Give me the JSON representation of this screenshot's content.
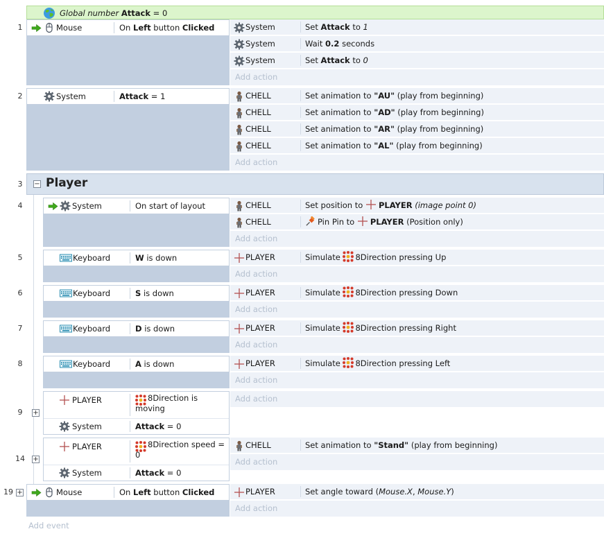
{
  "global_var": {
    "label_italic": "Global number",
    "name": "Attack",
    "value_text": "= 0"
  },
  "events": {
    "e1": {
      "num": "1",
      "cond_obj": "Mouse",
      "cond_pre": "On ",
      "cond_b": "Left",
      "cond_mid": " button ",
      "cond_b2": "Clicked",
      "actions": [
        {
          "obj": "System",
          "pre": "Set ",
          "b": "Attack",
          "mid": " to ",
          "i": "1"
        },
        {
          "obj": "System",
          "pre": "Wait ",
          "b": "0.2",
          "mid": " seconds"
        },
        {
          "obj": "System",
          "pre": "Set ",
          "b": "Attack",
          "mid": " to ",
          "i": "0"
        }
      ]
    },
    "e2": {
      "num": "2",
      "cond_obj": "System",
      "cond_b": "Attack",
      "cond_rest": " = 1",
      "actions": [
        {
          "obj": "CHELL",
          "pre": "Set animation to ",
          "b": "\"AU\"",
          "post": " (play from beginning)"
        },
        {
          "obj": "CHELL",
          "pre": "Set animation to ",
          "b": "\"AD\"",
          "post": " (play from beginning)"
        },
        {
          "obj": "CHELL",
          "pre": "Set animation to ",
          "b": "\"AR\"",
          "post": " (play from beginning)"
        },
        {
          "obj": "CHELL",
          "pre": "Set animation to ",
          "b": "\"AL\"",
          "post": " (play from beginning)"
        }
      ]
    },
    "g3": {
      "num": "3",
      "title": "Player",
      "collapse": "−"
    },
    "e4": {
      "num": "4",
      "cond_obj": "System",
      "cond_text": "On start of layout",
      "actions": [
        {
          "obj": "CHELL",
          "pre": "Set position to ",
          "b": "PLAYER",
          "i": " (image point 0)"
        },
        {
          "obj": "CHELL",
          "pre": "Pin Pin to ",
          "b": "PLAYER",
          "post": " (Position only)"
        }
      ]
    },
    "e5": {
      "num": "5",
      "cond_obj": "Keyboard",
      "cond_b": "W",
      "cond_rest": " is down",
      "act_obj": "PLAYER",
      "act_pre": "Simulate ",
      "act_post": "8Direction pressing Up"
    },
    "e6": {
      "num": "6",
      "cond_obj": "Keyboard",
      "cond_b": "S",
      "cond_rest": " is down",
      "act_obj": "PLAYER",
      "act_pre": "Simulate ",
      "act_post": "8Direction pressing Down"
    },
    "e7": {
      "num": "7",
      "cond_obj": "Keyboard",
      "cond_b": "D",
      "cond_rest": " is down",
      "act_obj": "PLAYER",
      "act_pre": "Simulate ",
      "act_post": "8Direction pressing Right"
    },
    "e8": {
      "num": "8",
      "cond_obj": "Keyboard",
      "cond_b": "A",
      "cond_rest": " is down",
      "act_obj": "PLAYER",
      "act_pre": "Simulate ",
      "act_post": "8Direction pressing Left"
    },
    "e9": {
      "num": "9",
      "expand": "+",
      "c1_obj": "PLAYER",
      "c1_text1": "8Direction is",
      "c1_text2": "moving",
      "c2_obj": "System",
      "c2_b": "Attack",
      "c2_rest": " = 0"
    },
    "e14": {
      "num": "14",
      "expand": "+",
      "c1_obj": "PLAYER",
      "c1_text1": "8Direction speed =",
      "c1_text2": "0",
      "c2_obj": "System",
      "c2_b": "Attack",
      "c2_rest": " = 0",
      "act_obj": "CHELL",
      "act_pre": "Set animation to ",
      "act_b": "\"Stand\"",
      "act_post": " (play from beginning)"
    },
    "e19": {
      "num": "19",
      "expand": "+",
      "cond_obj": "Mouse",
      "cond_pre": "On ",
      "cond_b": "Left",
      "cond_mid": " button ",
      "cond_b2": "Clicked",
      "act_obj": "PLAYER",
      "act_pre": "Set angle toward (",
      "act_i1": "Mouse.X",
      "act_mid": ", ",
      "act_i2": "Mouse.Y",
      "act_post": ")"
    }
  },
  "add_action_label": "Add action",
  "add_event_label": "Add event",
  "icons": {
    "gear": "gear-icon",
    "mouse": "mouse-icon",
    "keyboard": "keyboard-icon",
    "sprite": "chell-sprite-icon",
    "cross": "player-cross-icon",
    "eight_dir": "8direction-behavior-icon",
    "pin": "pin-icon",
    "trigger": "trigger-arrow-icon",
    "globe": "globe-icon"
  },
  "colors": {
    "global_bg": "#dcf5cc",
    "event_bg": "#c2cfe0",
    "action_bg": "#eef2f8",
    "group_bg": "#d8e2ee",
    "trigger_green": "#3fa81c"
  }
}
